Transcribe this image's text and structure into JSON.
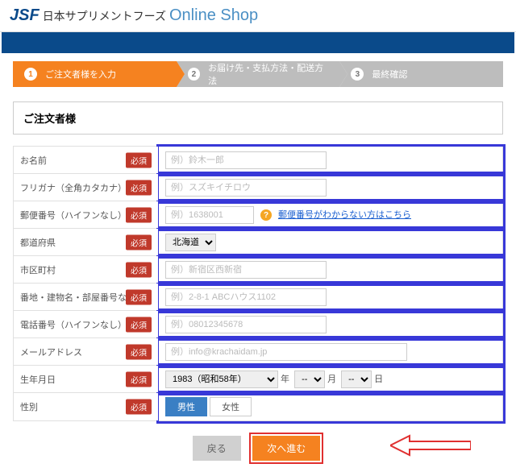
{
  "header": {
    "brand_prefix": "JSF",
    "brand_jp": "日本サプリメントフーズ",
    "brand_shop": "Online Shop"
  },
  "steps": {
    "s1": "ご注文者様を入力",
    "s2": "お届け先・支払方法・配送方法",
    "s3": "最終確認"
  },
  "section_title": "ご注文者様",
  "required_label": "必須",
  "labels": {
    "name": "お名前",
    "kana": "フリガナ（全角カタカナ）",
    "zip": "郵便番号（ハイフンなし）",
    "pref": "都道府県",
    "city": "市区町村",
    "addr": "番地・建物名・部屋番号など",
    "tel": "電話番号（ハイフンなし）",
    "mail": "メールアドレス",
    "dob": "生年月日",
    "gender": "性別"
  },
  "placeholders": {
    "name": "例）鈴木一郎",
    "kana": "例）スズキイチロウ",
    "zip": "例）1638001",
    "city": "例）新宿区西新宿",
    "addr": "例）2-8-1 ABCハウス1102",
    "tel": "例）08012345678",
    "mail": "例）info@krachaidam.jp"
  },
  "zip_link": "郵便番号がわからない方はこちら",
  "pref_value": "北海道",
  "dob": {
    "year": "1983（昭和58年）",
    "y": "年",
    "m": "月",
    "d": "日",
    "dash": "--"
  },
  "gender": {
    "male": "男性",
    "female": "女性"
  },
  "buttons": {
    "back": "戻る",
    "next": "次へ進む"
  }
}
